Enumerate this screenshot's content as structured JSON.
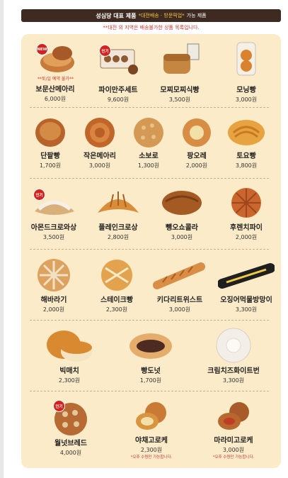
{
  "header": {
    "title": "성심당 대표 제품",
    "highlight": "*대전배송 · 방문픽업*",
    "tail": "가능 제품"
  },
  "notice": "**대전 외 지역은 배송불가한 상품 목록입니다.",
  "badges": {
    "new": "NEW",
    "popular": "인기"
  },
  "pickup_note": "**토/일 예약 불가**",
  "rows": [
    [
      {
        "name": "보문산메아리",
        "price": "6,000원"
      },
      {
        "name": "파이만주세트",
        "price": "9,600원"
      },
      {
        "name": "모찌모찌식빵",
        "price": "3,500원"
      },
      {
        "name": "모닝빵",
        "price": "3,000원"
      }
    ],
    [
      {
        "name": "단팥빵",
        "price": "1,700원"
      },
      {
        "name": "작은메아리",
        "price": "3,000원"
      },
      {
        "name": "소보로",
        "price": "1,300원"
      },
      {
        "name": "팡오레",
        "price": "2,000원"
      },
      {
        "name": "토요빵",
        "price": "3,800원"
      }
    ],
    [
      {
        "name": "아몬드크로와상",
        "price": "3,500원"
      },
      {
        "name": "플레인크로상",
        "price": "2,800원"
      },
      {
        "name": "뺑오쇼콜라",
        "price": "3,000원"
      },
      {
        "name": "후렌치파이",
        "price": "2,000원"
      }
    ],
    [
      {
        "name": "해바라기",
        "price": "2,000원"
      },
      {
        "name": "스테이크빵",
        "price": "2,300원"
      },
      {
        "name": "키다리트위스트",
        "price": "3,000원"
      },
      {
        "name": "오징어먹물방망이",
        "price": "3,300원"
      }
    ],
    [
      {
        "name": "빅매치",
        "price": "2,300원"
      },
      {
        "name": "빵도넛",
        "price": "1,700원"
      },
      {
        "name": "크림치즈화이트번",
        "price": "3,300원"
      }
    ],
    [
      {
        "name": "월넛브레드",
        "price": "4,000원"
      },
      {
        "name": "야채고로케",
        "price": "2,300원",
        "note": "*오후 수령만 가능합니다."
      },
      {
        "name": "마라미고로케",
        "price": "3,000원",
        "note": "*오후 수령만 가능합니다."
      }
    ]
  ]
}
